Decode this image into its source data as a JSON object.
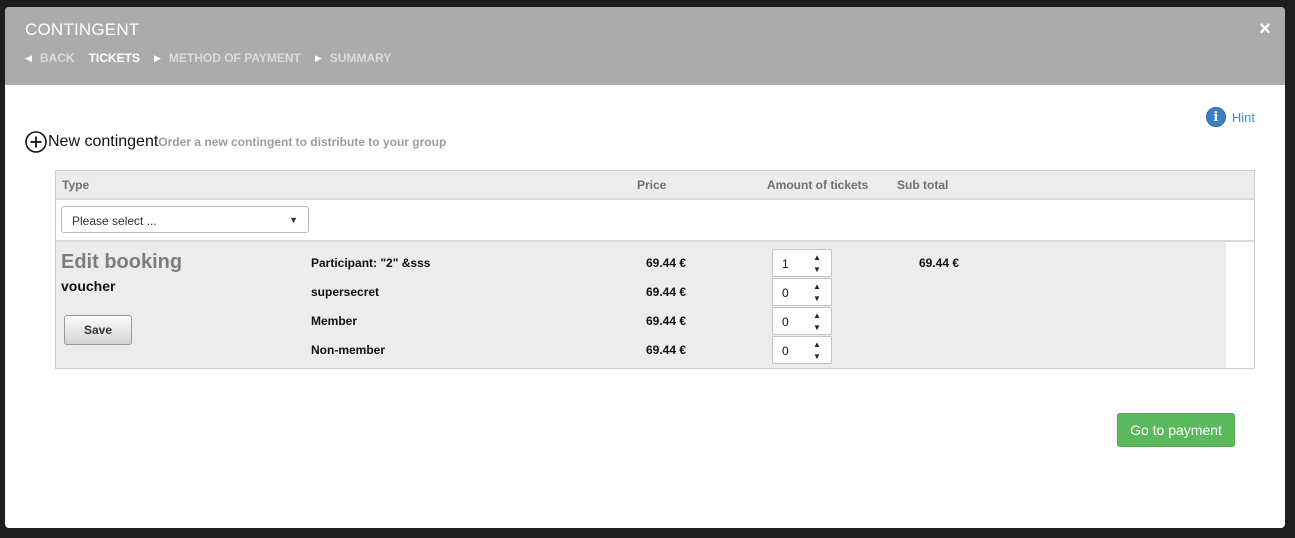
{
  "header": {
    "title": "CONTINGENT",
    "close_icon": "×",
    "breadcrumb": [
      {
        "label": "BACK",
        "arrow": "left"
      },
      {
        "label": "TICKETS",
        "active": true
      },
      {
        "label": "METHOD OF PAYMENT",
        "arrow": "right"
      },
      {
        "label": "SUMMARY",
        "arrow": "right"
      }
    ]
  },
  "hint": {
    "icon": "i",
    "label": "Hint"
  },
  "new_contingent": {
    "title": "New contingent",
    "subtitle": "Order a new contingent to distribute to your group"
  },
  "table": {
    "columns": [
      "Type",
      "Price",
      "Amount of tickets",
      "Sub total"
    ],
    "select": {
      "value": "Please select ..."
    },
    "booking": {
      "title": "Edit booking",
      "voucher": "voucher",
      "save_label": "Save",
      "rows": [
        {
          "name": "Participant: \"2\" &sss",
          "price": "69.44 €",
          "qty": "1",
          "subtotal": "69.44 €"
        },
        {
          "name": "supersecret",
          "price": "69.44 €",
          "qty": "0",
          "subtotal": ""
        },
        {
          "name": "Member",
          "price": "69.44 €",
          "qty": "0",
          "subtotal": ""
        },
        {
          "name": "Non-member",
          "price": "69.44 €",
          "qty": "0",
          "subtotal": ""
        }
      ]
    }
  },
  "footer": {
    "pay_label": "Go to payment"
  },
  "colors": {
    "header_bg": "#ababab",
    "pay_button": "#5cb85c",
    "hint_blue": "#3a7fc1"
  }
}
